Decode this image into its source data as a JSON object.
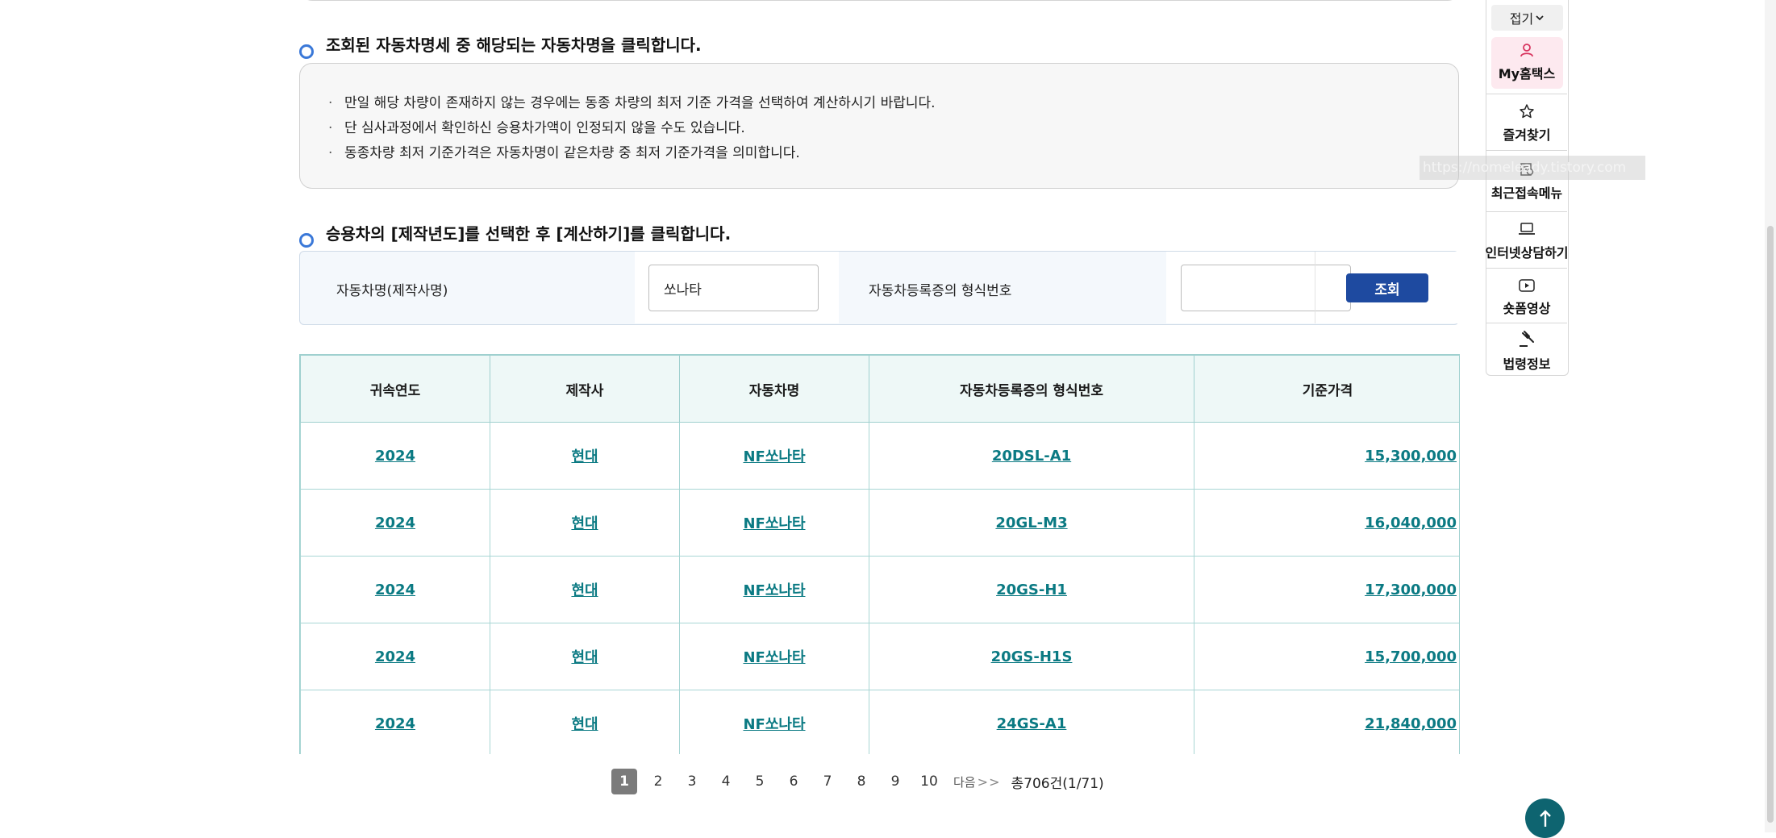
{
  "step1": {
    "title": "조회된 자동차명세 중 해당되는 자동차명을 클릭합니다."
  },
  "notice": {
    "items": [
      "만일 해당 차량이 존재하지 않는 경우에는 동종 차량의 최저 기준 가격을 선택하여 계산하시기 바랍니다.",
      "단 심사과정에서 확인하신 승용차가액이 인정되지 않을 수도 있습니다.",
      "동종차량 최저 기준가격은 자동차명이 같은차량 중  최저 기준가격을 의미합니다."
    ]
  },
  "step2": {
    "title": "승용차의 [제작년도]를 선택한 후 [계산하기]를 클릭합니다."
  },
  "search": {
    "car_name_label": "자동차명(제작사명)",
    "car_name_value": "쏘나타",
    "reg_label": "자동차등록증의 형식번호",
    "reg_value": "",
    "button_label": "조회"
  },
  "table": {
    "headers": [
      "귀속연도",
      "제작사",
      "자동차명",
      "자동차등록증의 형식번호",
      "기준가격"
    ],
    "rows": [
      [
        "2024",
        "현대",
        "NF쏘나타",
        "20DSL-A1",
        "15,300,000"
      ],
      [
        "2024",
        "현대",
        "NF쏘나타",
        "20GL-M3",
        "16,040,000"
      ],
      [
        "2024",
        "현대",
        "NF쏘나타",
        "20GS-H1",
        "17,300,000"
      ],
      [
        "2024",
        "현대",
        "NF쏘나타",
        "20GS-H1S",
        "15,700,000"
      ],
      [
        "2024",
        "현대",
        "NF쏘나타",
        "24GS-A1",
        "21,840,000"
      ],
      [
        "",
        "",
        "",
        "",
        ""
      ]
    ]
  },
  "pagination": {
    "pages": [
      "1",
      "2",
      "3",
      "4",
      "5",
      "6",
      "7",
      "8",
      "9",
      "10"
    ],
    "current": "1",
    "next_label": "다음",
    "last_arrows": "> >",
    "total": "총706건(1/71)"
  },
  "quick_panel": {
    "fold_label": "접기",
    "items": [
      {
        "label": "My홈택스",
        "icon": "person-icon"
      },
      {
        "label": "즐겨찾기",
        "icon": "star-icon"
      },
      {
        "label": "최근접속메뉴",
        "icon": "recent-menu-icon"
      },
      {
        "label": "인터넷상담하기",
        "icon": "laptop-icon"
      },
      {
        "label": "숏폼영상",
        "icon": "play-icon"
      },
      {
        "label": "법령정보",
        "icon": "gavel-icon"
      }
    ]
  },
  "watermark": "https://nomeleady.tistory.com",
  "colors": {
    "accent_blue": "#1e4aa0",
    "link_teal": "#0b7a83",
    "table_border": "#9fd0cf",
    "step_circle": "#3a78d8",
    "scroll_top_button": "#0e6470"
  }
}
